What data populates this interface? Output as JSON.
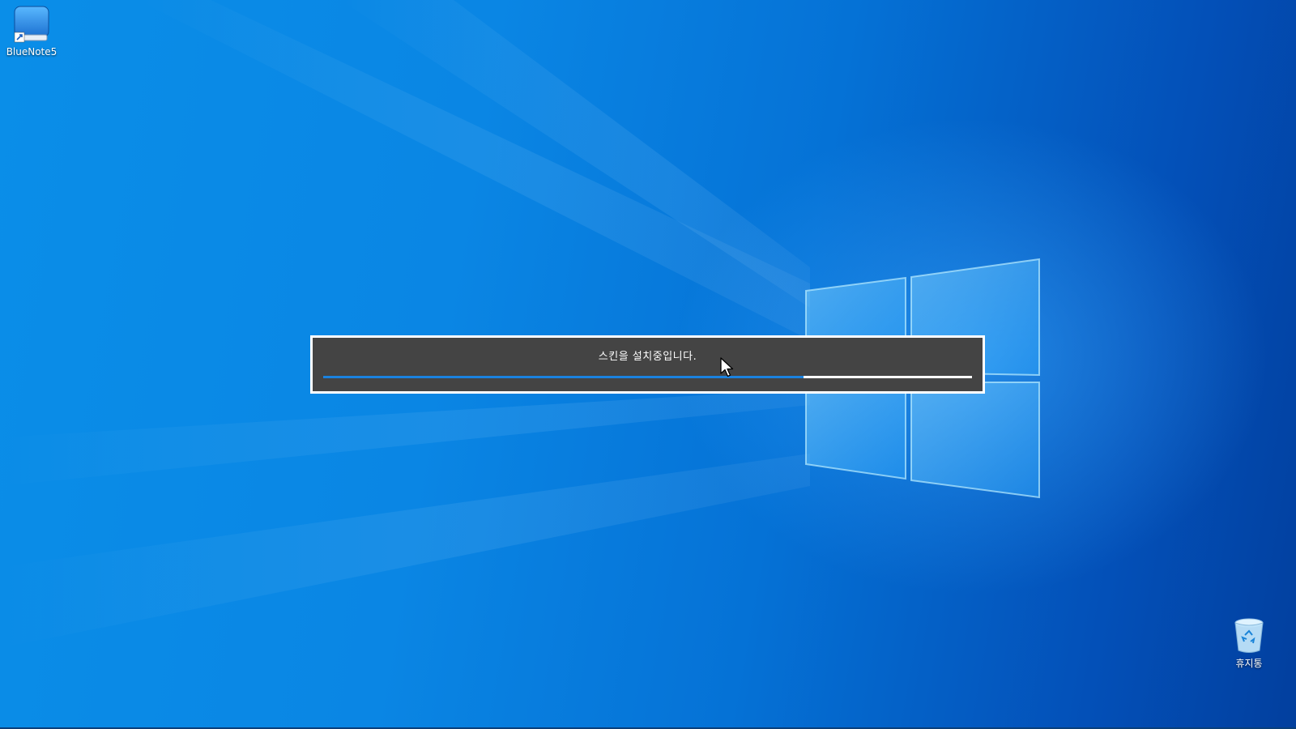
{
  "desktop": {
    "icons": [
      {
        "label": "BlueNote5",
        "icon": "bluenote-app-icon",
        "shortcut": true
      },
      {
        "label": "휴지통",
        "icon": "recycle-bin-icon",
        "shortcut": false
      }
    ]
  },
  "dialog": {
    "message": "스킨을 설치중입니다.",
    "progress": 0.74,
    "colors": {
      "background": "#444444",
      "border": "#ffffff",
      "progress_fill": "#1a82e0",
      "progress_track": "#ffffff"
    }
  },
  "theme": {
    "wallpaper": "windows-10-hero",
    "accent": "#0a86e4"
  }
}
